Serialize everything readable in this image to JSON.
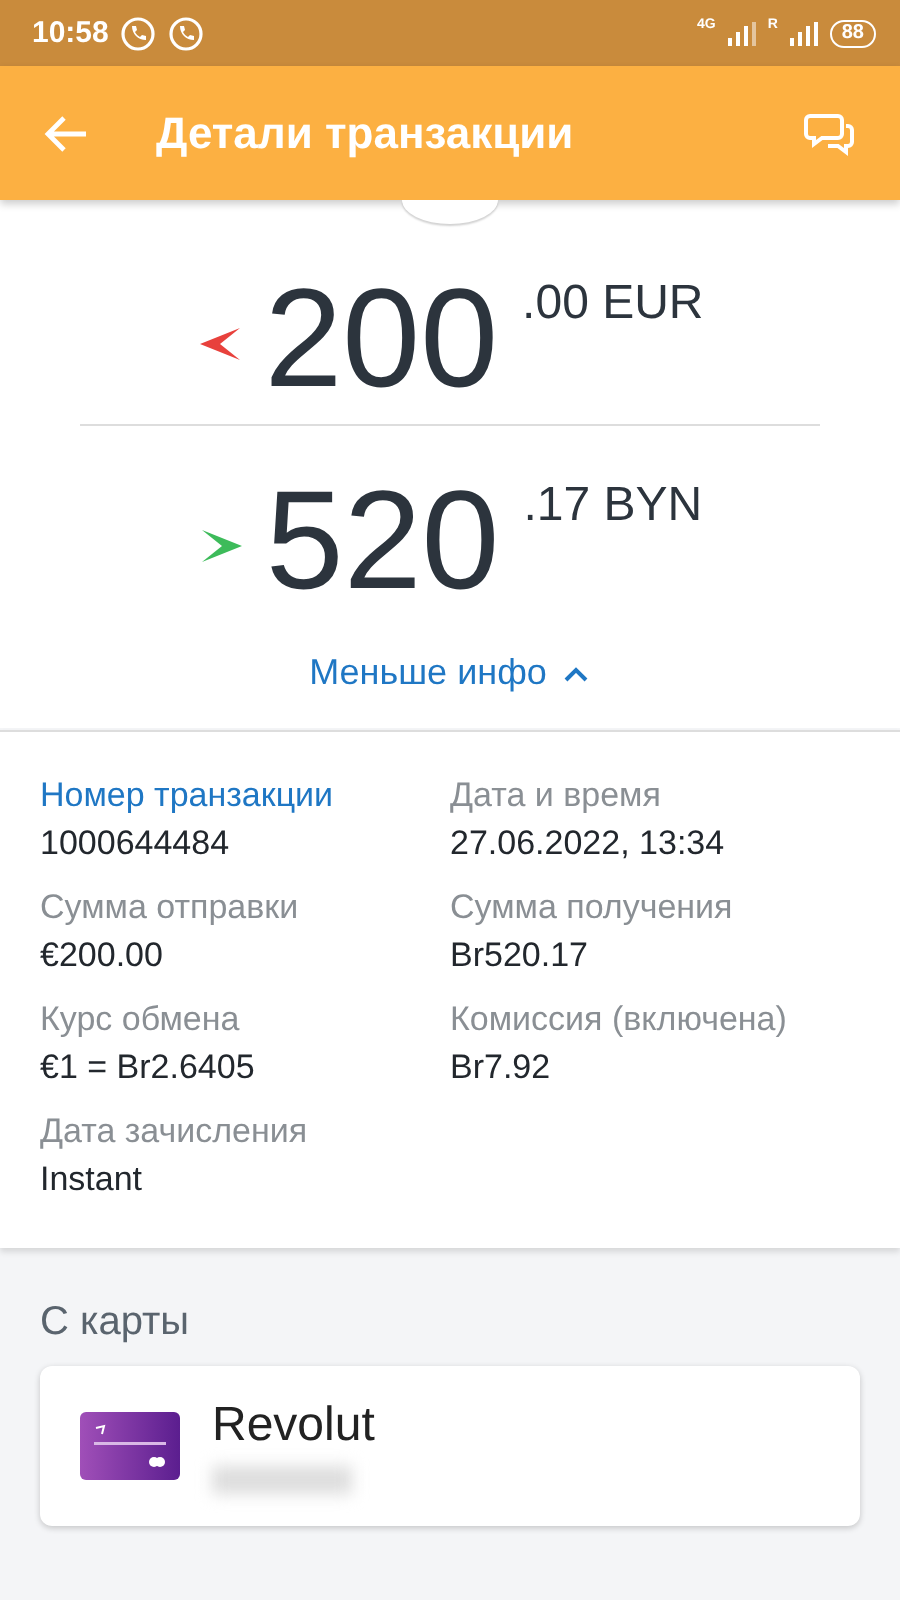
{
  "status_bar": {
    "time": "10:58",
    "network_1": "4G",
    "network_2": "R",
    "battery": "88"
  },
  "header": {
    "title": "Детали транзакции"
  },
  "amounts": [
    {
      "kind": "sent",
      "whole": "200",
      "fraction": ".00 EUR"
    },
    {
      "kind": "received",
      "whole": "520",
      "fraction": ".17 BYN"
    }
  ],
  "toggle": {
    "label": "Меньше инфо",
    "expanded": true
  },
  "details": [
    {
      "label": "Номер транзакции",
      "value": "1000644484",
      "highlighted": true
    },
    {
      "label": "Дата и время",
      "value": "27.06.2022, 13:34",
      "highlighted": false
    },
    {
      "label": "Сумма отправки",
      "value": "€200.00",
      "highlighted": false
    },
    {
      "label": "Сумма получения",
      "value": "Br520.17",
      "highlighted": false
    },
    {
      "label": "Курс обмена",
      "value": "€1 = Br2.6405",
      "highlighted": false
    },
    {
      "label": "Комиссия (включена)",
      "value": "Br7.92",
      "highlighted": false
    },
    {
      "label": "Дата зачисления",
      "value": "Instant",
      "highlighted": false
    }
  ],
  "source": {
    "heading": "С карты",
    "card_name": "Revolut"
  }
}
